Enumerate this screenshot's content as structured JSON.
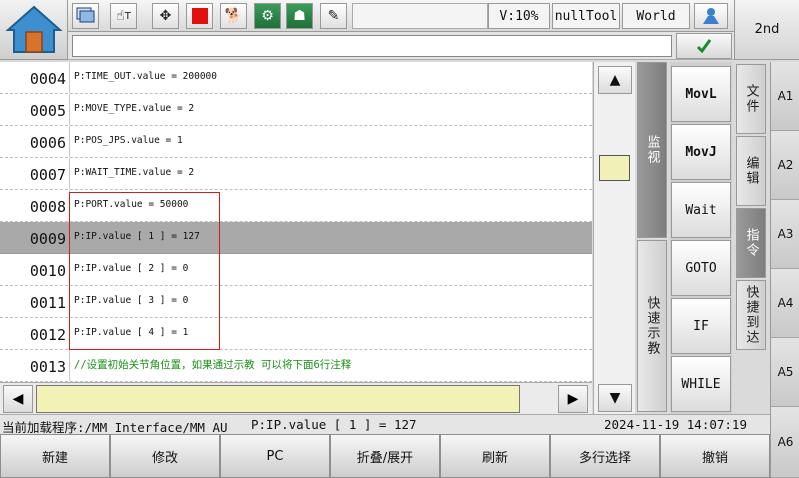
{
  "toolbar": {
    "icons": [
      "screen-icon",
      "hand-tool-icon",
      "move-arrows-icon",
      "stop-icon",
      "dog-icon",
      "robot-arm-icon",
      "person-icon",
      "notebook-icon"
    ],
    "velocity": "V:10%",
    "tool": "nullTool",
    "frame": "World",
    "second_label": "2nd"
  },
  "editor": {
    "lines": [
      {
        "num": "0004",
        "text": "P:TIME_OUT.value = 200000"
      },
      {
        "num": "0005",
        "text": "P:MOVE_TYPE.value = 2"
      },
      {
        "num": "0006",
        "text": "P:POS_JPS.value = 1"
      },
      {
        "num": "0007",
        "text": "P:WAIT_TIME.value = 2"
      },
      {
        "num": "0008",
        "text": "P:PORT.value = 50000"
      },
      {
        "num": "0009",
        "text": "P:IP.value [ 1 ] = 127"
      },
      {
        "num": "0010",
        "text": "P:IP.value [ 2 ] = 0"
      },
      {
        "num": "0011",
        "text": "P:IP.value [ 3 ] = 0"
      },
      {
        "num": "0012",
        "text": "P:IP.value [ 4 ] = 1"
      },
      {
        "num": "0013",
        "text": "//设置初始关节角位置，如果通过示教 可以将下面6行注释"
      }
    ],
    "selected_index": 5
  },
  "side_tabs": {
    "monitor": "监视",
    "quick_teach": "快速示教"
  },
  "commands": [
    "MovL",
    "MovJ",
    "Wait",
    "GOTO",
    "IF",
    "WHILE"
  ],
  "right_tabs": [
    "文件",
    "编辑",
    "指令",
    "快捷到达"
  ],
  "active_right_tab": 2,
  "a_labels": [
    "A1",
    "A2",
    "A3",
    "A4",
    "A5",
    "A6"
  ],
  "footer": {
    "program": "当前加载程序:/MM_Interface/MM_AU",
    "current_line": "P:IP.value [ 1 ] = 127",
    "datetime": "2024-11-19 14:07:19"
  },
  "bottom_buttons": [
    "新建",
    "修改",
    "PC",
    "折叠/展开",
    "刷新",
    "多行选择",
    "撤销"
  ],
  "colors": {
    "selected_row": "#a9a9a9",
    "highlight_box": "#d41c1c",
    "comment": "#1a8f1a",
    "input_yellow": "#f3f2b6"
  }
}
